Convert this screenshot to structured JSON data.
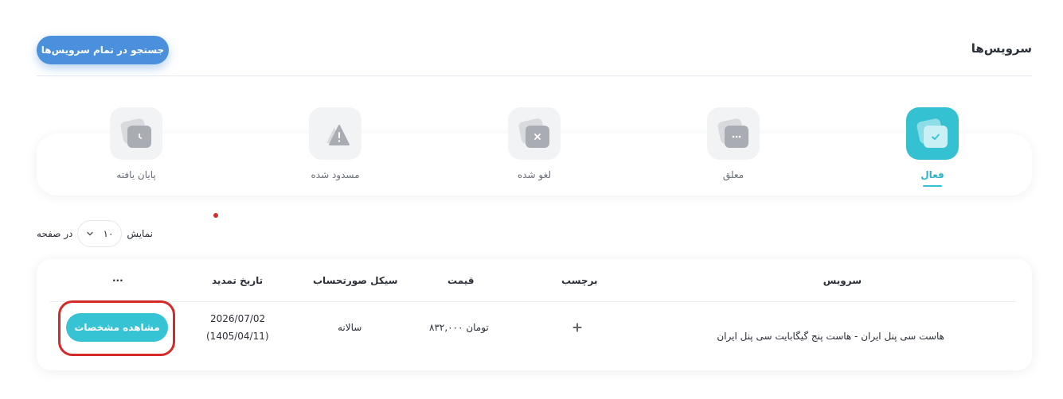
{
  "header": {
    "title": "سرویس‌ها",
    "search_all_label": "جستجو در تمام سرویس‌ها"
  },
  "tabs": [
    {
      "label": "فعال",
      "icon": "check-icon",
      "active": true
    },
    {
      "label": "معلق",
      "icon": "ellipsis-icon",
      "active": false
    },
    {
      "label": "لغو شده",
      "icon": "x-icon",
      "active": false
    },
    {
      "label": "مسدود شده",
      "icon": "warning-icon",
      "active": false
    },
    {
      "label": "پایان یافته",
      "icon": "clock-icon",
      "active": false
    }
  ],
  "pagination": {
    "show_label": "نمایش",
    "per_page_value": "۱۰",
    "per_page_suffix": "در صفحه"
  },
  "table": {
    "columns": {
      "service": "سرویس",
      "tag": "برچسب",
      "price": "قیمت",
      "billing_cycle": "سیکل صورتحساب",
      "renewal_date": "تاریخ تمدید",
      "more": "..."
    },
    "rows": [
      {
        "service": "هاست سی پنل ایران - هاست پنج گیگابایت سی پنل ایران",
        "tag_icon": "plus-icon",
        "price": "۸۳۲,۰۰۰ تومان",
        "billing_cycle": "سالانه",
        "renewal_date": "2026/07/02",
        "renewal_date_alt": "(1405/04/11)",
        "action_label": "مشاهده مشخصات"
      }
    ]
  },
  "colors": {
    "primary_blue": "#4a90dc",
    "accent_teal": "#36c4d4",
    "annotation_red": "#d42a2a"
  }
}
